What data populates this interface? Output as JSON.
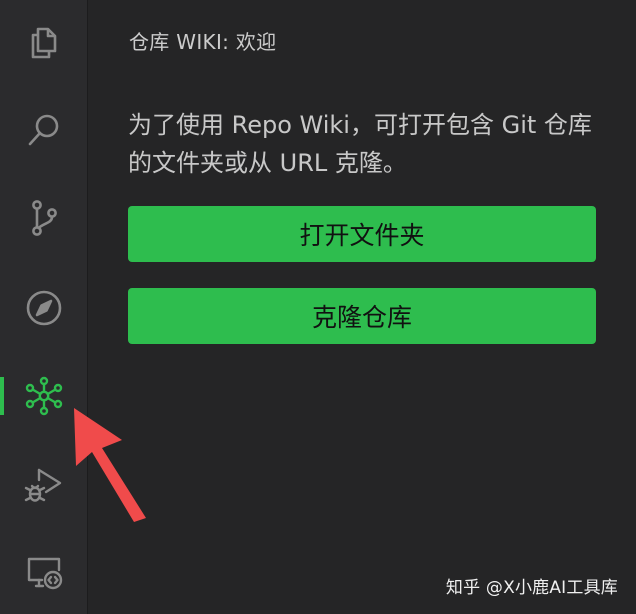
{
  "sidebar": {
    "title": "仓库 WIKI: 欢迎",
    "message": "为了使用 Repo Wiki，可打开包含 Git 仓库的文件夹或从 URL 克隆。",
    "open_folder_label": "打开文件夹",
    "clone_repo_label": "克隆仓库"
  },
  "activity_bar": {
    "items": [
      {
        "icon": "files-icon"
      },
      {
        "icon": "search-icon"
      },
      {
        "icon": "source-control-icon"
      },
      {
        "icon": "compass-icon"
      },
      {
        "icon": "repo-wiki-icon",
        "active": true
      },
      {
        "icon": "run-debug-icon"
      },
      {
        "icon": "remote-explorer-icon"
      }
    ]
  },
  "watermark": "知乎 @X小鹿AI工具库",
  "colors": {
    "accent": "#2ebd4e",
    "background": "#252526",
    "activity_bar": "#2b2b2d",
    "arrow": "#f04b4b"
  }
}
